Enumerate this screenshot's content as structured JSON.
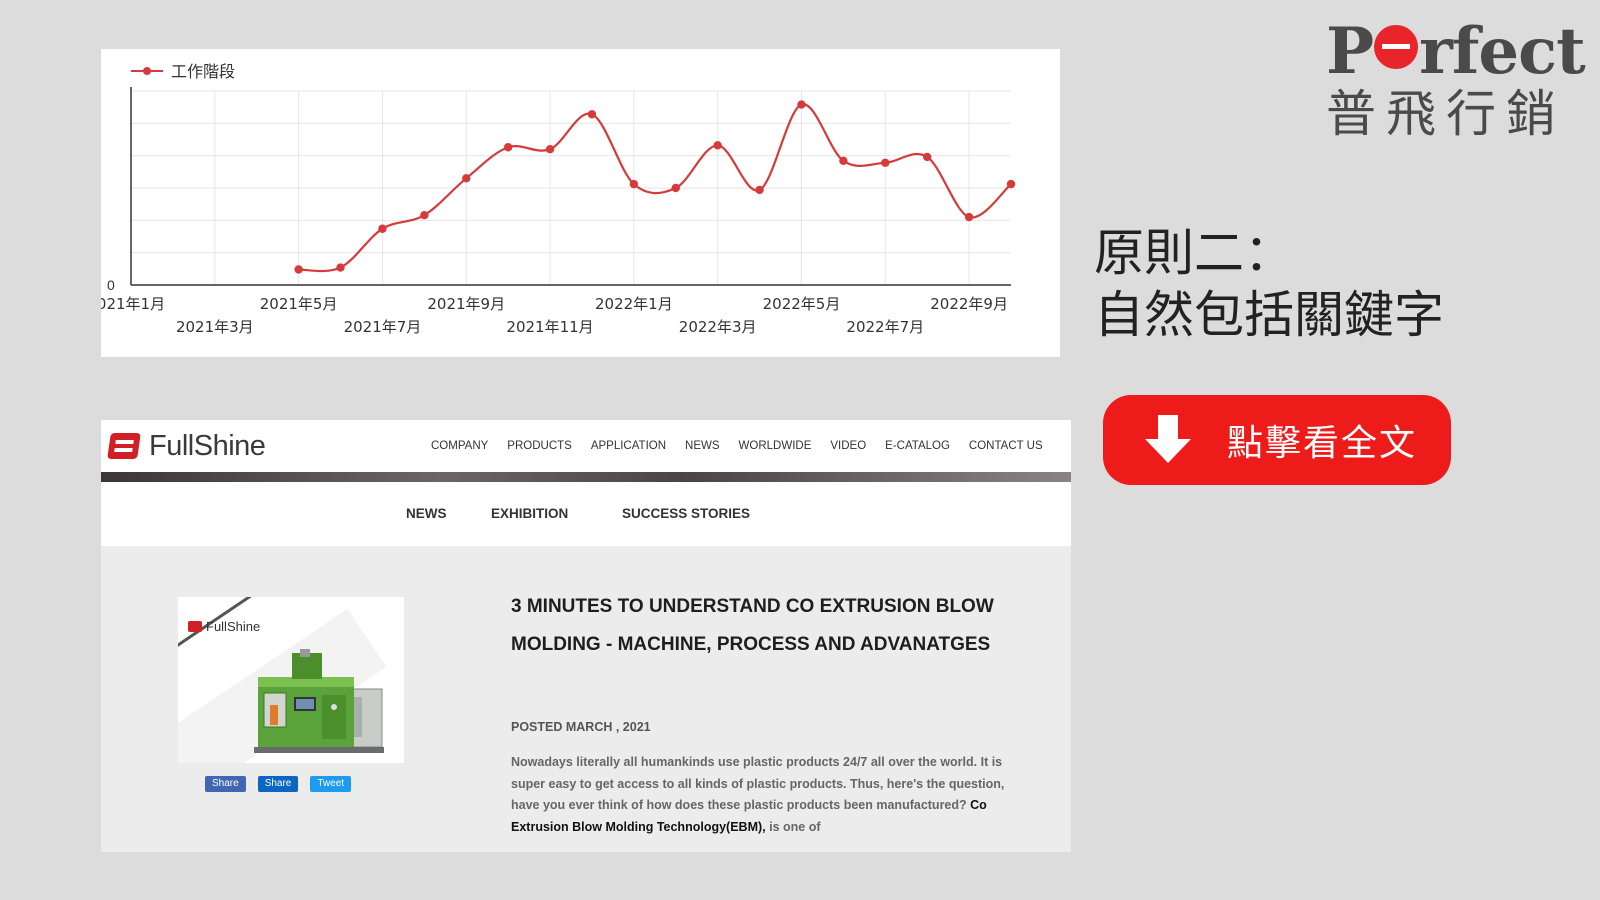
{
  "chart_data": {
    "type": "line",
    "legend": [
      "工作階段"
    ],
    "legend_position": "top-left",
    "series_color": "#d63a3a",
    "x_tick_labels_row1": [
      "021年1月",
      "2021年5月",
      "2021年9月",
      "2022年1月",
      "2022年5月",
      "2022年9月"
    ],
    "x_tick_labels_row2": [
      "2021年3月",
      "2021年7月",
      "2021年11月",
      "2022年3月",
      "2022年7月"
    ],
    "y_tick_labels": [
      "0"
    ],
    "x": [
      "2021-01",
      "2021-02",
      "2021-03",
      "2021-04",
      "2021-05",
      "2021-06",
      "2021-07",
      "2021-08",
      "2021-09",
      "2021-10",
      "2021-11",
      "2021-12",
      "2022-01",
      "2022-02",
      "2022-03",
      "2022-04",
      "2022-05",
      "2022-06",
      "2022-07",
      "2022-08",
      "2022-09",
      "2022-10"
    ],
    "values": [
      null,
      null,
      null,
      null,
      8,
      9,
      29,
      36,
      55,
      71,
      70,
      88,
      52,
      50,
      72,
      49,
      93,
      64,
      63,
      66,
      35,
      52
    ],
    "ylim": [
      0,
      100
    ],
    "grid": true
  },
  "brand": {
    "top": "Perfect",
    "top_prefix": "P",
    "top_suffix": "rfect",
    "bottom": "普飛行銷",
    "color": "#4a4a4a",
    "accent": "#e8252a"
  },
  "heading": {
    "line1": "原則二：",
    "line2": "自然包括關鍵字"
  },
  "cta": {
    "label": "點擊看全文",
    "color": "#ee1b1b",
    "icon": "arrow-down-icon"
  },
  "site": {
    "logo_text": "FullShine",
    "nav": [
      "COMPANY",
      "PRODUCTS",
      "APPLICATION",
      "NEWS",
      "WORLDWIDE",
      "VIDEO",
      "E-CATALOG",
      "CONTACT US"
    ],
    "subnav": [
      "NEWS",
      "EXHIBITION",
      "SUCCESS STORIES"
    ],
    "thumb_logo": "FullShine",
    "share": [
      "Share",
      "Share",
      "Tweet"
    ],
    "article": {
      "title": "3 MINUTES TO UNDERSTAND CO EXTRUSION BLOW MOLDING - MACHINE, PROCESS AND ADVANATGES",
      "date": "POSTED MARCH , 2021",
      "body_pre": "Nowadays literally all humankinds use plastic products 24/7 all over the world. It is super easy to get access to all kinds of plastic products. Thus, here's the question, have you ever think of how does these plastic products been manufactured? ",
      "body_link": "Co Extrusion Blow Molding Technology(EBM),",
      "body_post": " is one of"
    }
  }
}
